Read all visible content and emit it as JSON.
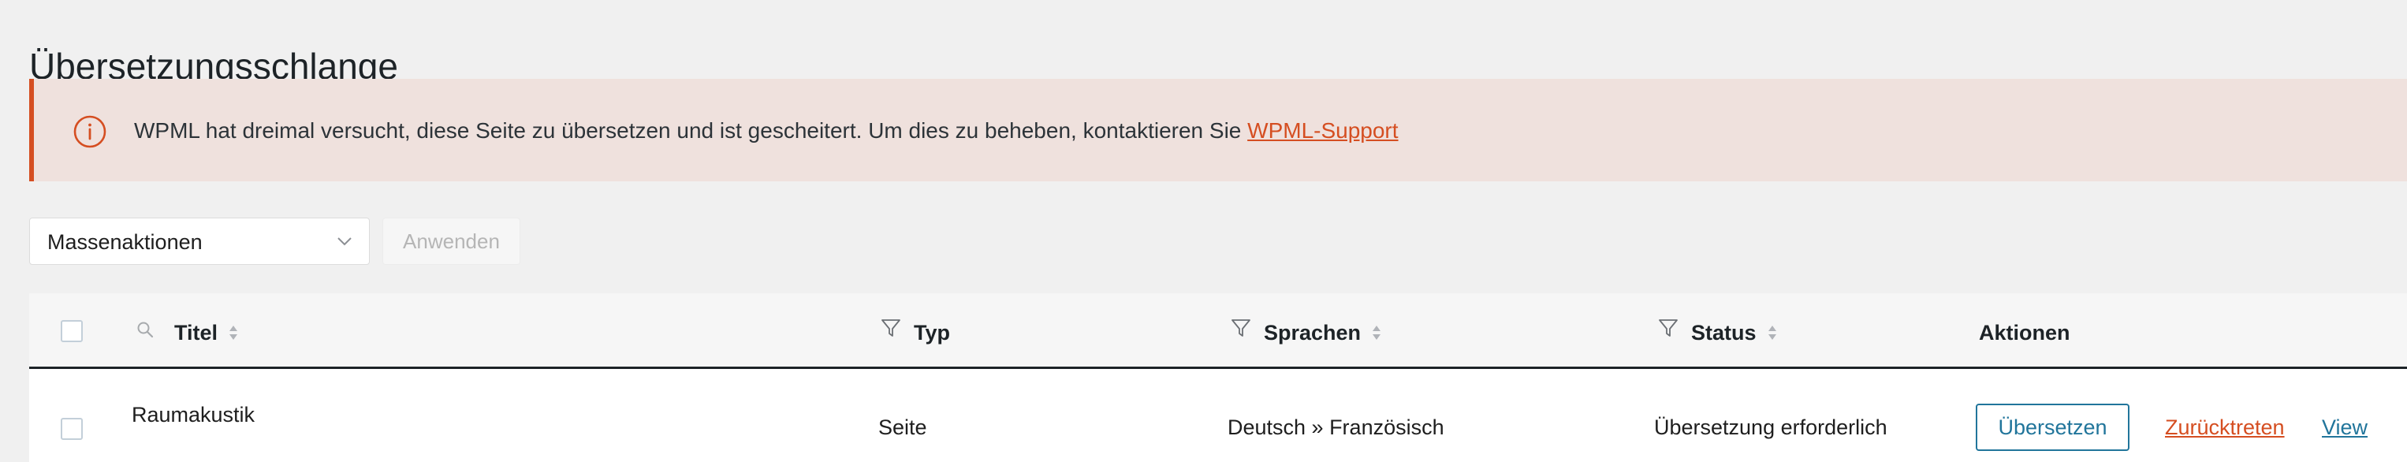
{
  "page": {
    "title": "Übersetzungsschlange"
  },
  "notice": {
    "icon": "info-circle-icon",
    "message": "WPML hat dreimal versucht, diese Seite zu übersetzen und ist gescheitert. Um dies zu beheben, kontaktieren Sie ",
    "link_label": "WPML-Support",
    "accent_color": "#d54e21",
    "background_color": "#efe1dd"
  },
  "toolbar": {
    "bulk_actions_selected": "Massenaktionen",
    "apply_label": "Anwenden"
  },
  "table": {
    "columns": {
      "title": "Titel",
      "type": "Typ",
      "languages": "Sprachen",
      "status": "Status",
      "actions": "Aktionen"
    },
    "rows": [
      {
        "title": "Raumakustik",
        "type": "Seite",
        "languages": "Deutsch » Französisch",
        "status": "Übersetzung erforderlich",
        "actions": {
          "translate": "Übersetzen",
          "retract": "Zurücktreten",
          "view": "View"
        }
      }
    ]
  },
  "colors": {
    "link_blue": "#21759b",
    "link_orange": "#d54e21"
  }
}
